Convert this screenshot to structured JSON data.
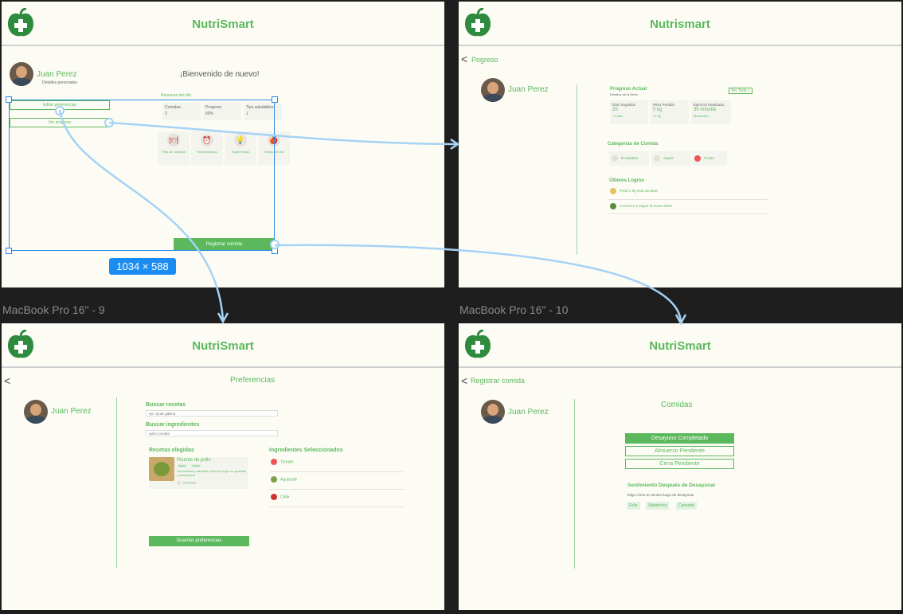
{
  "colors": {
    "brand_green": "#5cb85c",
    "selection_blue": "#2d8ae6",
    "canvas": "#1e1e1e",
    "frame_bg": "#fcfcf5"
  },
  "frame_labels": {
    "f3": "MacBook Pro 16\" - 9",
    "f4": "MacBook Pro 16\" - 10"
  },
  "selection_badge": "1034 × 588",
  "user": {
    "name": "Juan Perez",
    "details": "Detalles personales"
  },
  "home": {
    "app_title": "NutriSmart",
    "welcome": "¡Bienvenido de nuevo!",
    "edit_preferences": "Editar preferencias",
    "view_progress": "Ver progreso",
    "summary_title": "Resumen del día",
    "stats": [
      {
        "label": "Comidas",
        "value": "3"
      },
      {
        "label": "Progreso",
        "value": "60%"
      },
      {
        "label": "Tips saludables",
        "value": "1"
      }
    ],
    "cards": [
      {
        "icon": "plate-icon",
        "glyph": "🍽",
        "label": "Plan de comidas"
      },
      {
        "icon": "alarm-icon",
        "glyph": "⏰",
        "label": "Recordatorios"
      },
      {
        "icon": "bulb-icon",
        "glyph": "💡",
        "label": "Sugerencias"
      },
      {
        "icon": "apple-icon",
        "glyph": "🍎",
        "label": "Snack del día"
      }
    ],
    "register_meal": "Registrar comida"
  },
  "progress": {
    "app_title": "Nutrismart",
    "back_label": "Pogreso",
    "section_title": "Progreso Actual",
    "section_subtitle": "Detalles de la Dieta",
    "see_all": "Ver Todo >",
    "stats": [
      {
        "label": "Días Seguidos",
        "value": "20",
        "delta": "+3 días"
      },
      {
        "label": "Peso Perdido",
        "value": "5 kg",
        "delta": "+1 kg"
      },
      {
        "label": "Ejercicio Realizado",
        "value": "30 min/día",
        "delta": "Mantenido"
      }
    ],
    "categories_title": "Categorías de Comida",
    "categories": [
      {
        "icon": "salad-icon",
        "glyph": "🥗",
        "label": "Ensaladas"
      },
      {
        "icon": "soup-icon",
        "glyph": "🥣",
        "label": "Sopas"
      },
      {
        "icon": "fruit-icon",
        "glyph": "🍓",
        "label": "Frutas"
      }
    ],
    "achievements_title": "Últimos Logros",
    "achievements": [
      {
        "icon": "trophy-icon",
        "glyph": "🏆",
        "label": "Perdí 2 kg esta semana"
      },
      {
        "icon": "leaf-icon",
        "glyph": "🥦",
        "label": "Comencé a seguir la nueva dieta"
      }
    ]
  },
  "preferences": {
    "app_title": "NutriSmart",
    "back_glyph": "<",
    "page_title": "Preferencias",
    "search_recipes": {
      "label": "Buscar recetas",
      "value": "ejs: aji de gallina"
    },
    "search_ingredients": {
      "label": "Buscar ingredientes",
      "value": "ejem: tomate"
    },
    "chosen_recipes_title": "Recetas elegidas",
    "recipe": {
      "title": "Picante de pollo",
      "tags": [
        "Algún",
        "Lorem"
      ],
      "description": "Una deliciosa y saludable receta de sorgo con aguacate y salsa picante",
      "author": "Chef Maria"
    },
    "selected_ingredients_title": "Ingredientes Seleccionados",
    "ingredients": [
      {
        "icon": "tomato-icon",
        "glyph": "🍅",
        "label": "Tomate"
      },
      {
        "icon": "avocado-icon",
        "glyph": "🥑",
        "label": "Aguacate"
      },
      {
        "icon": "chili-icon",
        "glyph": "🌶",
        "label": "Chile"
      }
    ],
    "save": "Guardar preferencias"
  },
  "register": {
    "app_title": "NutriSmart",
    "back_label": "Registrar comida",
    "meals_title": "Comidas",
    "meals": [
      "Desayuno Completado",
      "Almuerzo Pendiente",
      "Cena Pendiente"
    ],
    "feeling_title": "Sentimiento Después de Desayunar",
    "feeling_prompt": "Elige cómo te sientes luego de desayunar",
    "feelings": [
      "Feliz",
      "Satisfecho",
      "Cansado"
    ]
  }
}
